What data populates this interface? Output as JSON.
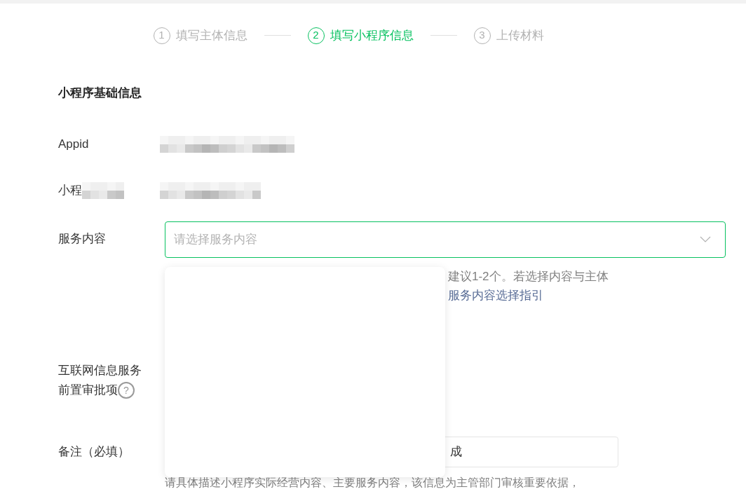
{
  "steps": [
    {
      "number": "1",
      "label": "填写主体信息",
      "selected": false
    },
    {
      "number": "2",
      "label": "填写小程序信息",
      "selected": true
    },
    {
      "number": "3",
      "label": "上传材料",
      "selected": false
    }
  ],
  "section_title": "小程序基础信息",
  "appid": {
    "label": "Appid"
  },
  "name": {
    "label": "小程"
  },
  "service": {
    "label": "服务内容",
    "placeholder": "请选择服务内容",
    "hint_lines": [
      "建议1-2个。若选择内容与主体"
    ],
    "hint_link": "服务内容选择指引"
  },
  "approval": {
    "label_lines": [
      "互联网信息服务",
      "前置审批项"
    ],
    "help_icon": "?"
  },
  "remark": {
    "label": "备注（必填）",
    "value": "成",
    "hint": "请具体描述小程序实际经营内容、主要服务内容，该信息为主管部门审核重要依据，"
  }
}
